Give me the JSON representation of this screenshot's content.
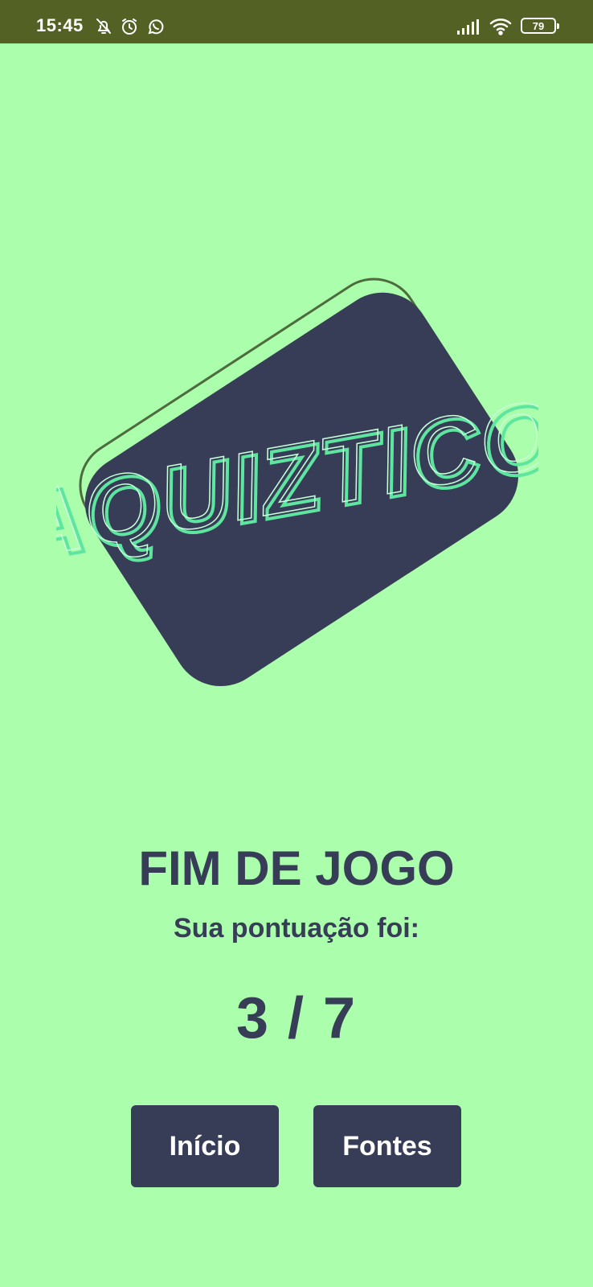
{
  "status_bar": {
    "time": "15:45",
    "battery": "79",
    "icons": [
      "bell-off-icon",
      "alarm-icon",
      "whatsapp-icon",
      "signal-icon",
      "wifi-icon",
      "battery-icon"
    ]
  },
  "logo": {
    "text": "AQUIZTICO",
    "card_color": "#373d56",
    "glow_color": "#5ee6a0"
  },
  "result": {
    "title": "FIM DE JOGO",
    "subtitle": "Sua pontuação foi:",
    "score": "3 / 7"
  },
  "buttons": {
    "home_label": "Início",
    "sources_label": "Fontes"
  },
  "colors": {
    "background": "#abfeab",
    "status_bar": "#536125",
    "text": "#373d56",
    "button": "#373d56"
  }
}
